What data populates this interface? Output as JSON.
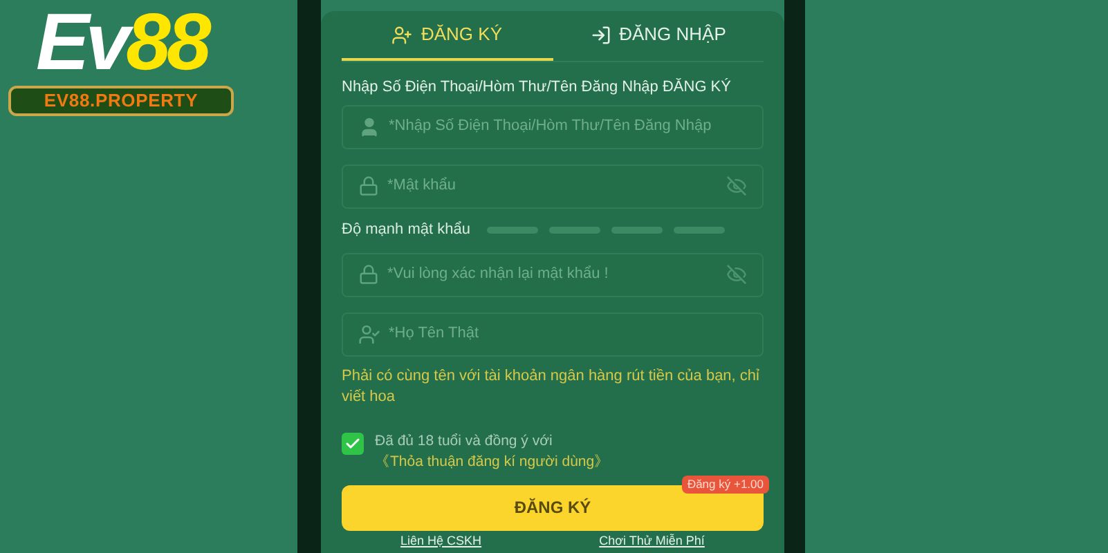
{
  "logo": {
    "prefix": "Ev",
    "number": "88",
    "domain": "EV88.PROPERTY"
  },
  "tabs": [
    {
      "label": "ĐĂNG KÝ",
      "kind": "register",
      "selected": true
    },
    {
      "label": "ĐĂNG NHẬP",
      "kind": "login",
      "selected": false
    }
  ],
  "form": {
    "label": "Nhập Số Điện Thoại/Hòm Thư/Tên Đăng Nhập ĐĂNG KÝ",
    "fields": [
      {
        "kind": "user",
        "placeholder": "*Nhập Số Điện Thoại/Hòm Thư/Tên Đăng Nhập"
      },
      {
        "kind": "password",
        "placeholder": "*Mật khẩu"
      },
      {
        "kind": "strength",
        "label": "Độ mạnh mật khẩu"
      },
      {
        "kind": "password",
        "placeholder": "*Vui lòng xác nhận lại mật khẩu !"
      },
      {
        "kind": "realname",
        "placeholder": "*Họ Tên Thật"
      }
    ],
    "hint": "Phải có cùng tên với tài khoản ngân hàng rút tiền của bạn, chỉ viết hoa",
    "agreement": {
      "checked": true,
      "text": "Đã đủ 18 tuổi và đồng ý với",
      "link": "《Thỏa thuận đăng kí người dùng》"
    },
    "submit": {
      "label": "ĐĂNG KÝ",
      "badge": "Đăng ký +1.00"
    },
    "links": [
      "Liên Hệ CSKH",
      "Chơi Thử Miễn Phí"
    ]
  }
}
